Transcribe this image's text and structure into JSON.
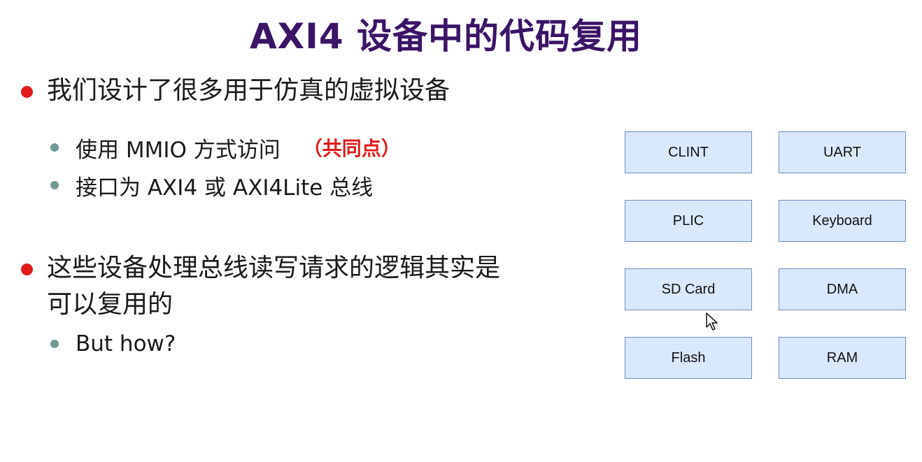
{
  "slide": {
    "title": "AXI4 设备中的代码复用",
    "bullets": [
      {
        "text": "我们设计了很多用于仿真的虚拟设备",
        "sub": [
          {
            "text": "使用 MMIO 方式访问",
            "note": "（共同点）"
          },
          {
            "text": "接口为 AXI4 或 AXI4Lite 总线"
          }
        ]
      },
      {
        "text_line1": "这些设备处理总线读写请求的逻辑其实是",
        "text_line2": "可以复用的",
        "sub": [
          {
            "text": "But how?"
          }
        ]
      }
    ]
  },
  "devices": [
    "CLINT",
    "UART",
    "PLIC",
    "Keyboard",
    "SD Card",
    "DMA",
    "Flash",
    "RAM"
  ],
  "colors": {
    "title": "#3b1466",
    "bullet_l1": "#e31b1b",
    "bullet_l2": "#6f9a97",
    "highlight": "#e31b1b",
    "box_fill": "#dae8fc",
    "box_border": "#6c8ebf"
  }
}
